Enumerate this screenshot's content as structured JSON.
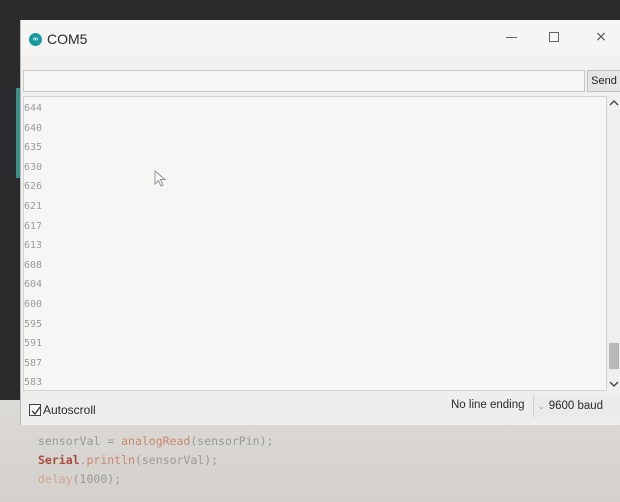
{
  "window": {
    "title": "COM5",
    "controls": {
      "minimize": "—",
      "close": "×"
    }
  },
  "input": {
    "value": "",
    "send_label": "Send"
  },
  "output": {
    "lines": [
      "644",
      "640",
      "635",
      "630",
      "626",
      "621",
      "617",
      "613",
      "608",
      "604",
      "600",
      "595",
      "591",
      "587",
      "583"
    ]
  },
  "scrollbar": {
    "up": "^",
    "down": "˅"
  },
  "bottom": {
    "autoscroll_label": "Autoscroll",
    "autoscroll_checked": true,
    "line_ending": "No line ending",
    "baud": "9600 baud",
    "baud_arrow": "⌄"
  },
  "editor": {
    "line1": {
      "a": "sensorVal",
      "b": " = ",
      "c": "analogRead",
      "d": "(sensorPin);"
    },
    "line2": {
      "a": "Serial",
      "b": ".",
      "c": "println",
      "d": "(sensorVal);"
    },
    "line3": {
      "a": "delay",
      "b": "(1000);"
    }
  },
  "colors": {
    "accent": "#159aa1",
    "output_text": "#9b9b9b"
  },
  "icons": {
    "app": "arduino-infinity-icon",
    "cursor": "mouse-pointer-icon"
  }
}
